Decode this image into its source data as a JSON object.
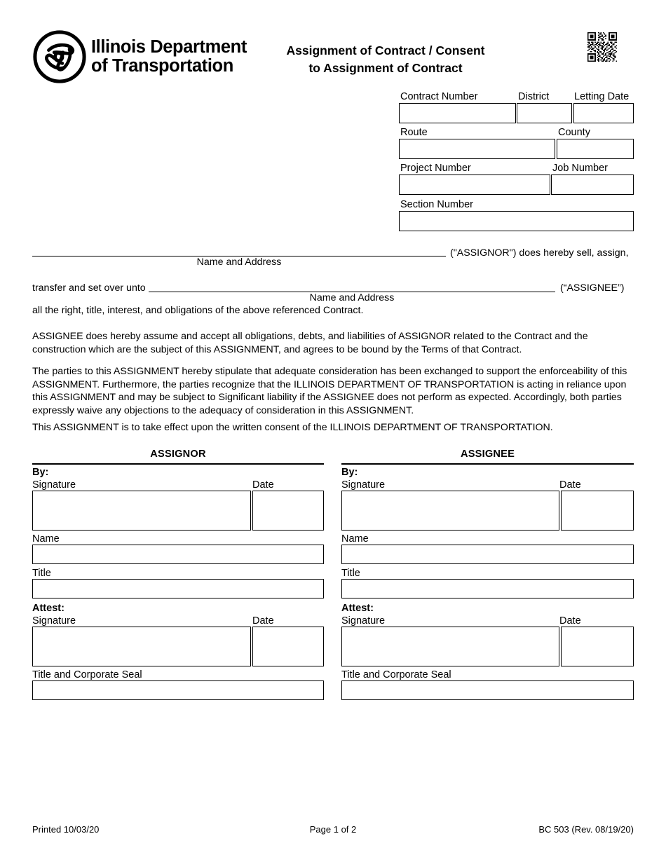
{
  "header": {
    "agency_line1": "Illinois Department",
    "agency_line2": "of Transportation",
    "title_line1": "Assignment of Contract / Consent",
    "title_line2": "to Assignment of Contract",
    "logo_icon": "idot-circle-emblem-icon",
    "qr_icon": "qr-code-icon"
  },
  "fields": {
    "contract_number": {
      "label": "Contract Number",
      "value": ""
    },
    "district": {
      "label": "District",
      "value": ""
    },
    "letting_date": {
      "label": "Letting Date",
      "value": ""
    },
    "route": {
      "label": "Route",
      "value": ""
    },
    "county": {
      "label": "County",
      "value": ""
    },
    "project_number": {
      "label": "Project Number",
      "value": ""
    },
    "job_number": {
      "label": "Job Number",
      "value": ""
    },
    "section_number": {
      "label": "Section Number",
      "value": ""
    }
  },
  "assignor_line": {
    "caption": "Name and Address",
    "trailing_text": "(\"ASSIGNOR\") does hereby sell, assign,",
    "value": ""
  },
  "assignee_line": {
    "lead_text": "transfer and set over unto",
    "caption": "Name and Address",
    "trailing_text": "(“ASSIGNEE”)",
    "value": ""
  },
  "body": {
    "line_after_assignee": "all the right, title, interest, and obligations of the above referenced Contract.",
    "paragraph_1": "ASSIGNEE does hereby assume and accept all obligations, debts, and liabilities of ASSIGNOR related to the Contract and the construction which are the subject of this ASSIGNMENT, and agrees to be bound by the Terms of that Contract.",
    "paragraph_2": "The parties to this ASSIGNMENT hereby stipulate that adequate consideration has been exchanged to support the enforceability of this ASSIGNMENT.  Furthermore, the parties recognize that the ILLINOIS DEPARTMENT OF TRANSPORTATION is acting in reliance upon this ASSIGNMENT and may be subject to Significant liability if the ASSIGNEE does not perform as expected.  Accordingly, both parties expressly waive any objections to the adequacy of consideration in this ASSIGNMENT.",
    "paragraph_3": "This ASSIGNMENT is to take effect upon the written consent of the ILLINOIS DEPARTMENT OF TRANSPORTATION."
  },
  "assignor_block": {
    "heading": "ASSIGNOR",
    "by_label": "By:",
    "signature_label": "Signature",
    "date_label": "Date",
    "name_label": "Name",
    "title_label": "Title",
    "attest_label": "Attest:",
    "attest_signature_label": "Signature",
    "attest_date_label": "Date",
    "title_seal_label": "Title and Corporate Seal",
    "signature_value": "",
    "date_value": "",
    "name_value": "",
    "title_value": "",
    "attest_signature_value": "",
    "attest_date_value": "",
    "title_seal_value": ""
  },
  "assignee_block": {
    "heading": "ASSIGNEE",
    "by_label": "By:",
    "signature_label": "Signature",
    "date_label": "Date",
    "name_label": "Name",
    "title_label": "Title",
    "attest_label": "Attest:",
    "attest_signature_label": "Signature",
    "attest_date_label": "Date",
    "title_seal_label": "Title and Corporate Seal",
    "signature_value": "",
    "date_value": "",
    "name_value": "",
    "title_value": "",
    "attest_signature_value": "",
    "attest_date_value": "",
    "title_seal_value": ""
  },
  "footer": {
    "printed": "Printed 10/03/20",
    "page": "Page 1 of 2",
    "form_id": "BC 503 (Rev. 08/19/20)"
  }
}
